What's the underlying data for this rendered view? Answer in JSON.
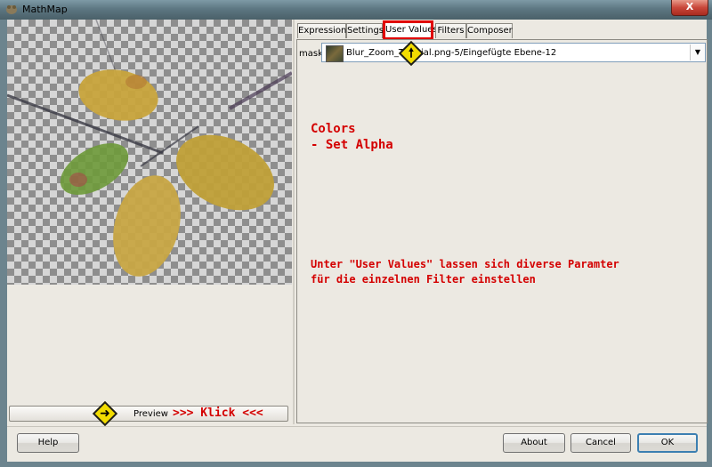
{
  "window": {
    "title": "MathMap",
    "close_label": "X"
  },
  "tabs": [
    {
      "label": "Expression",
      "active": false
    },
    {
      "label": "Settings",
      "active": false
    },
    {
      "label": "User Values",
      "active": true
    },
    {
      "label": "Filters",
      "active": false
    },
    {
      "label": "Composer",
      "active": false
    }
  ],
  "user_values": {
    "mask_label": "mask",
    "mask_value": "Blur_Zoom_Tutorial.png-5/Eingefügte Ebene-12"
  },
  "annotations": {
    "colors_title": "Colors",
    "colors_item": "- Set Alpha",
    "note_line1": "Unter \"User Values\" lassen sich diverse Paramter",
    "note_line2": "für die einzelnen Filter einstellen",
    "klick": ">>> Klick <<<"
  },
  "preview": {
    "button_label": "Preview"
  },
  "buttons": {
    "help": "Help",
    "about": "About",
    "cancel": "Cancel",
    "ok": "OK"
  },
  "icons": {
    "tab_marker": "arrow-up-icon",
    "preview_marker": "arrow-right-icon",
    "combo_arrow": "chevron-down-icon"
  },
  "colors": {
    "annotation_red": "#d40000",
    "highlight_red": "#e00000",
    "marker_yellow": "#f2dc00"
  }
}
